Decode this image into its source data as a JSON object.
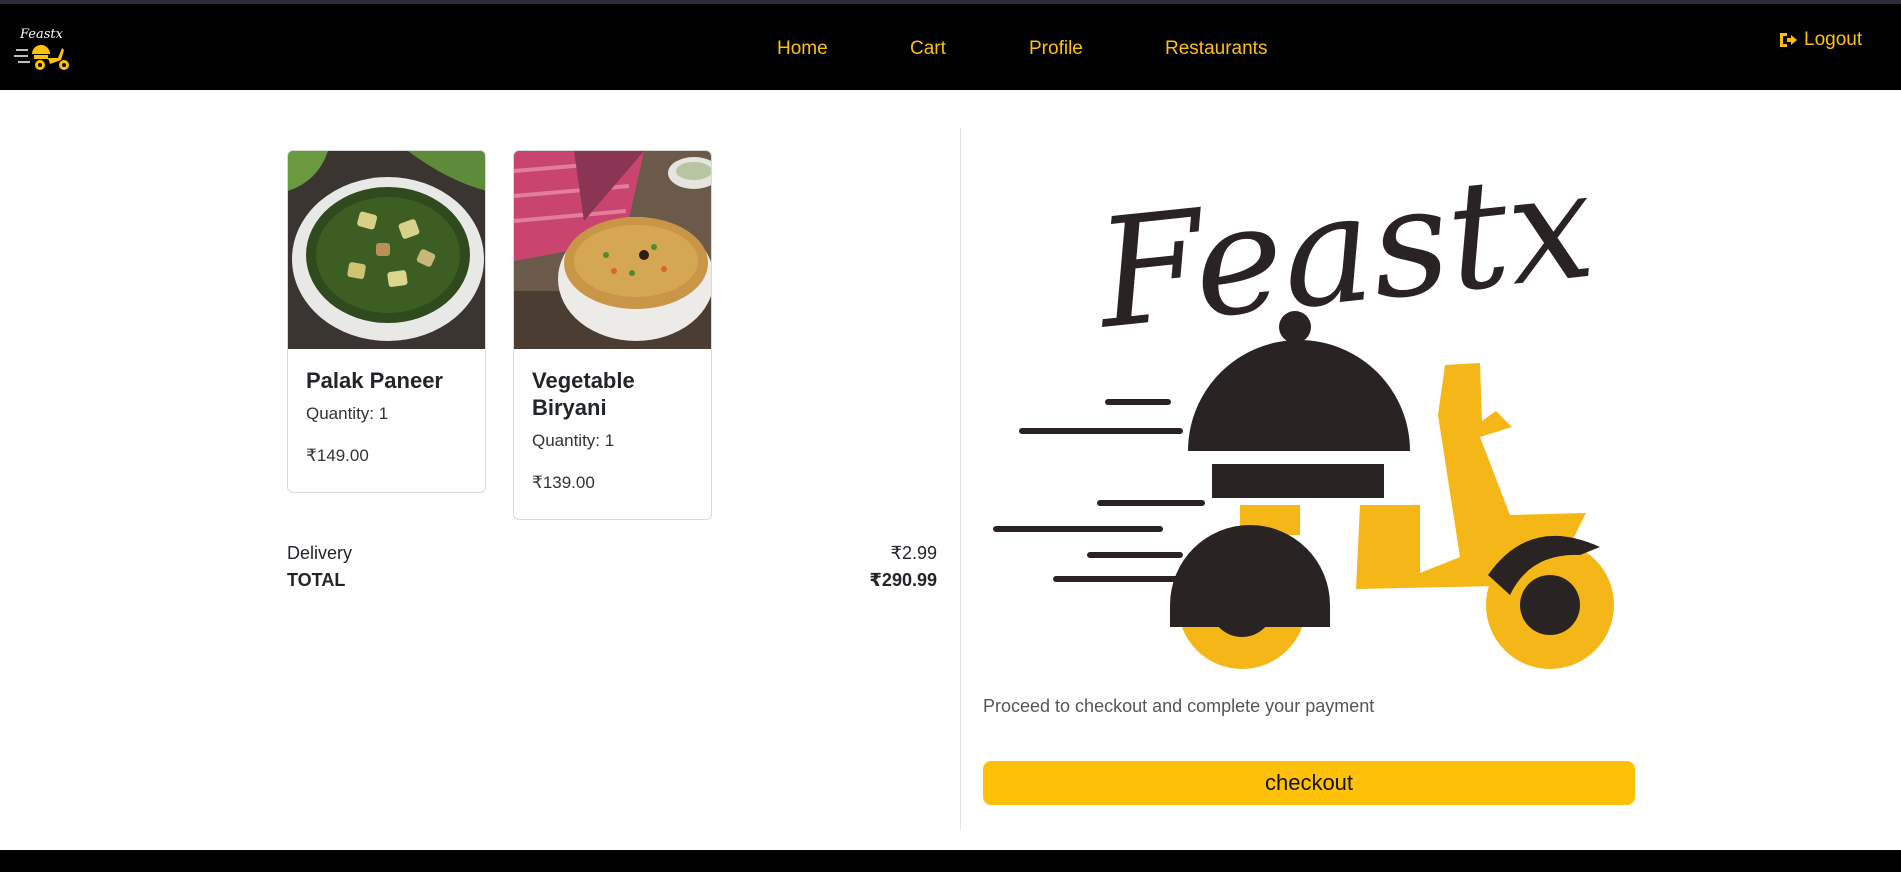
{
  "nav": {
    "brand_logo": "feastx-logo",
    "links": [
      "Home",
      "Cart",
      "Profile",
      "Restaurants"
    ],
    "logout_label": "Logout",
    "logout_icon": "logout-icon",
    "accent_color": "#ffc107"
  },
  "cart": {
    "items": [
      {
        "name": "Palak Paneer",
        "quantity": "Quantity: 1",
        "price": "₹149.00",
        "image": "palak-paneer-dish"
      },
      {
        "name": "Vegetable Biryani",
        "quantity": "Quantity: 1",
        "price": "₹139.00",
        "image": "vegetable-biryani-dish"
      }
    ],
    "delivery_label": "Delivery",
    "delivery_value": "₹2.99",
    "total_label": "TOTAL",
    "total_value": "₹290.99"
  },
  "checkout": {
    "logo": "feastx-logo",
    "message": "Proceed to checkout and complete your payment",
    "button_label": "checkout",
    "button_color": "#ffc107"
  }
}
